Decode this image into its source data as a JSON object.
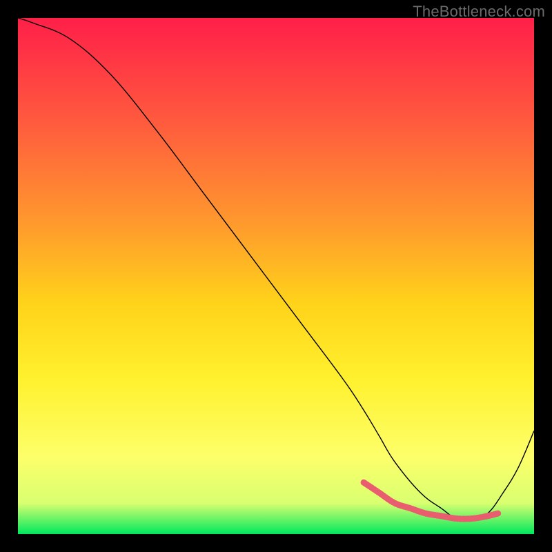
{
  "watermark": "TheBottleneck.com",
  "chart_data": {
    "type": "line",
    "title": "",
    "xlabel": "",
    "ylabel": "",
    "xlim": [
      0,
      100
    ],
    "ylim": [
      0,
      100
    ],
    "series": [
      {
        "name": "curve",
        "x": [
          0,
          3,
          10,
          18,
          27,
          36,
          45,
          54,
          63,
          67,
          70,
          73,
          78,
          82,
          85,
          88,
          91,
          94,
          97,
          100
        ],
        "values": [
          100,
          99,
          96,
          89,
          78,
          66,
          54,
          42,
          30,
          24,
          19,
          14,
          8,
          5,
          3,
          3,
          4,
          8,
          13,
          20
        ]
      },
      {
        "name": "highlight",
        "x": [
          67,
          70,
          73,
          76,
          79,
          82,
          85,
          88,
          91,
          93
        ],
        "values": [
          10,
          8,
          6,
          5,
          4,
          3.5,
          3,
          3,
          3.5,
          4
        ]
      }
    ],
    "gradient_stops": [
      {
        "offset": 0,
        "color": "#ff1f49"
      },
      {
        "offset": 20,
        "color": "#ff5a3e"
      },
      {
        "offset": 40,
        "color": "#ff9a2d"
      },
      {
        "offset": 55,
        "color": "#ffd21a"
      },
      {
        "offset": 70,
        "color": "#fff12e"
      },
      {
        "offset": 85,
        "color": "#fdff6a"
      },
      {
        "offset": 94,
        "color": "#d9ff70"
      },
      {
        "offset": 100,
        "color": "#00e85e"
      }
    ],
    "colors": {
      "curve": "#000000",
      "highlight": "#e85e6f"
    }
  }
}
